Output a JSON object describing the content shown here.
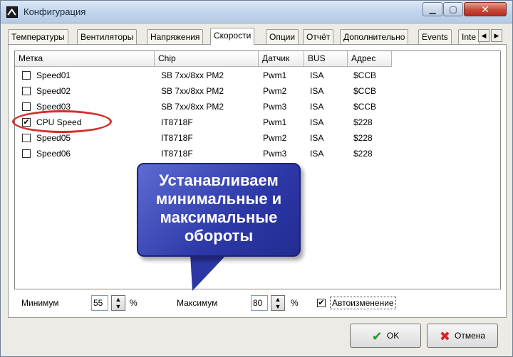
{
  "window": {
    "title": "Конфигурация"
  },
  "tabs": [
    {
      "label": "Температуры"
    },
    {
      "label": "Вентиляторы"
    },
    {
      "label": "Напряжения"
    },
    {
      "label": "Скорости"
    },
    {
      "label": "Опции"
    },
    {
      "label": "Отчёт"
    },
    {
      "label": "Дополнительно"
    },
    {
      "label": "Events"
    },
    {
      "label": "Inte"
    }
  ],
  "columns": [
    "Метка",
    "Chip",
    "Датчик",
    "BUS",
    "Адрес"
  ],
  "rows": [
    {
      "checked": "",
      "label": "Speed01",
      "chip": "SB 7xx/8xx PM2",
      "sensor": "Pwm1",
      "bus": "ISA",
      "address": "$CCB"
    },
    {
      "checked": "",
      "label": "Speed02",
      "chip": "SB 7xx/8xx PM2",
      "sensor": "Pwm2",
      "bus": "ISA",
      "address": "$CCB"
    },
    {
      "checked": "",
      "label": "Speed03",
      "chip": "SB 7xx/8xx PM2",
      "sensor": "Pwm3",
      "bus": "ISA",
      "address": "$CCB"
    },
    {
      "checked": "✔",
      "label": "CPU Speed",
      "chip": "IT8718F",
      "sensor": "Pwm1",
      "bus": "ISA",
      "address": "$228"
    },
    {
      "checked": "",
      "label": "Speed05",
      "chip": "IT8718F",
      "sensor": "Pwm2",
      "bus": "ISA",
      "address": "$228"
    },
    {
      "checked": "",
      "label": "Speed06",
      "chip": "IT8718F",
      "sensor": "Pwm3",
      "bus": "ISA",
      "address": "$228"
    }
  ],
  "callout": {
    "line1": "Устанавливаем",
    "line2": "минимальные и",
    "line3": "максимальные",
    "line4": "обороты"
  },
  "controls": {
    "min_label": "Минимум",
    "min_value": "55",
    "max_label": "Максимум",
    "max_value": "80",
    "percent": "%",
    "auto_checked": "✔",
    "auto_label": "Автоизменение"
  },
  "buttons": {
    "ok": "OK",
    "cancel": "Отмена"
  },
  "colors": {
    "highlight": "#d92c2c",
    "callout": "#2d38a8",
    "ok_icon": "#2c9a2c",
    "cancel_icon": "#d42424"
  }
}
